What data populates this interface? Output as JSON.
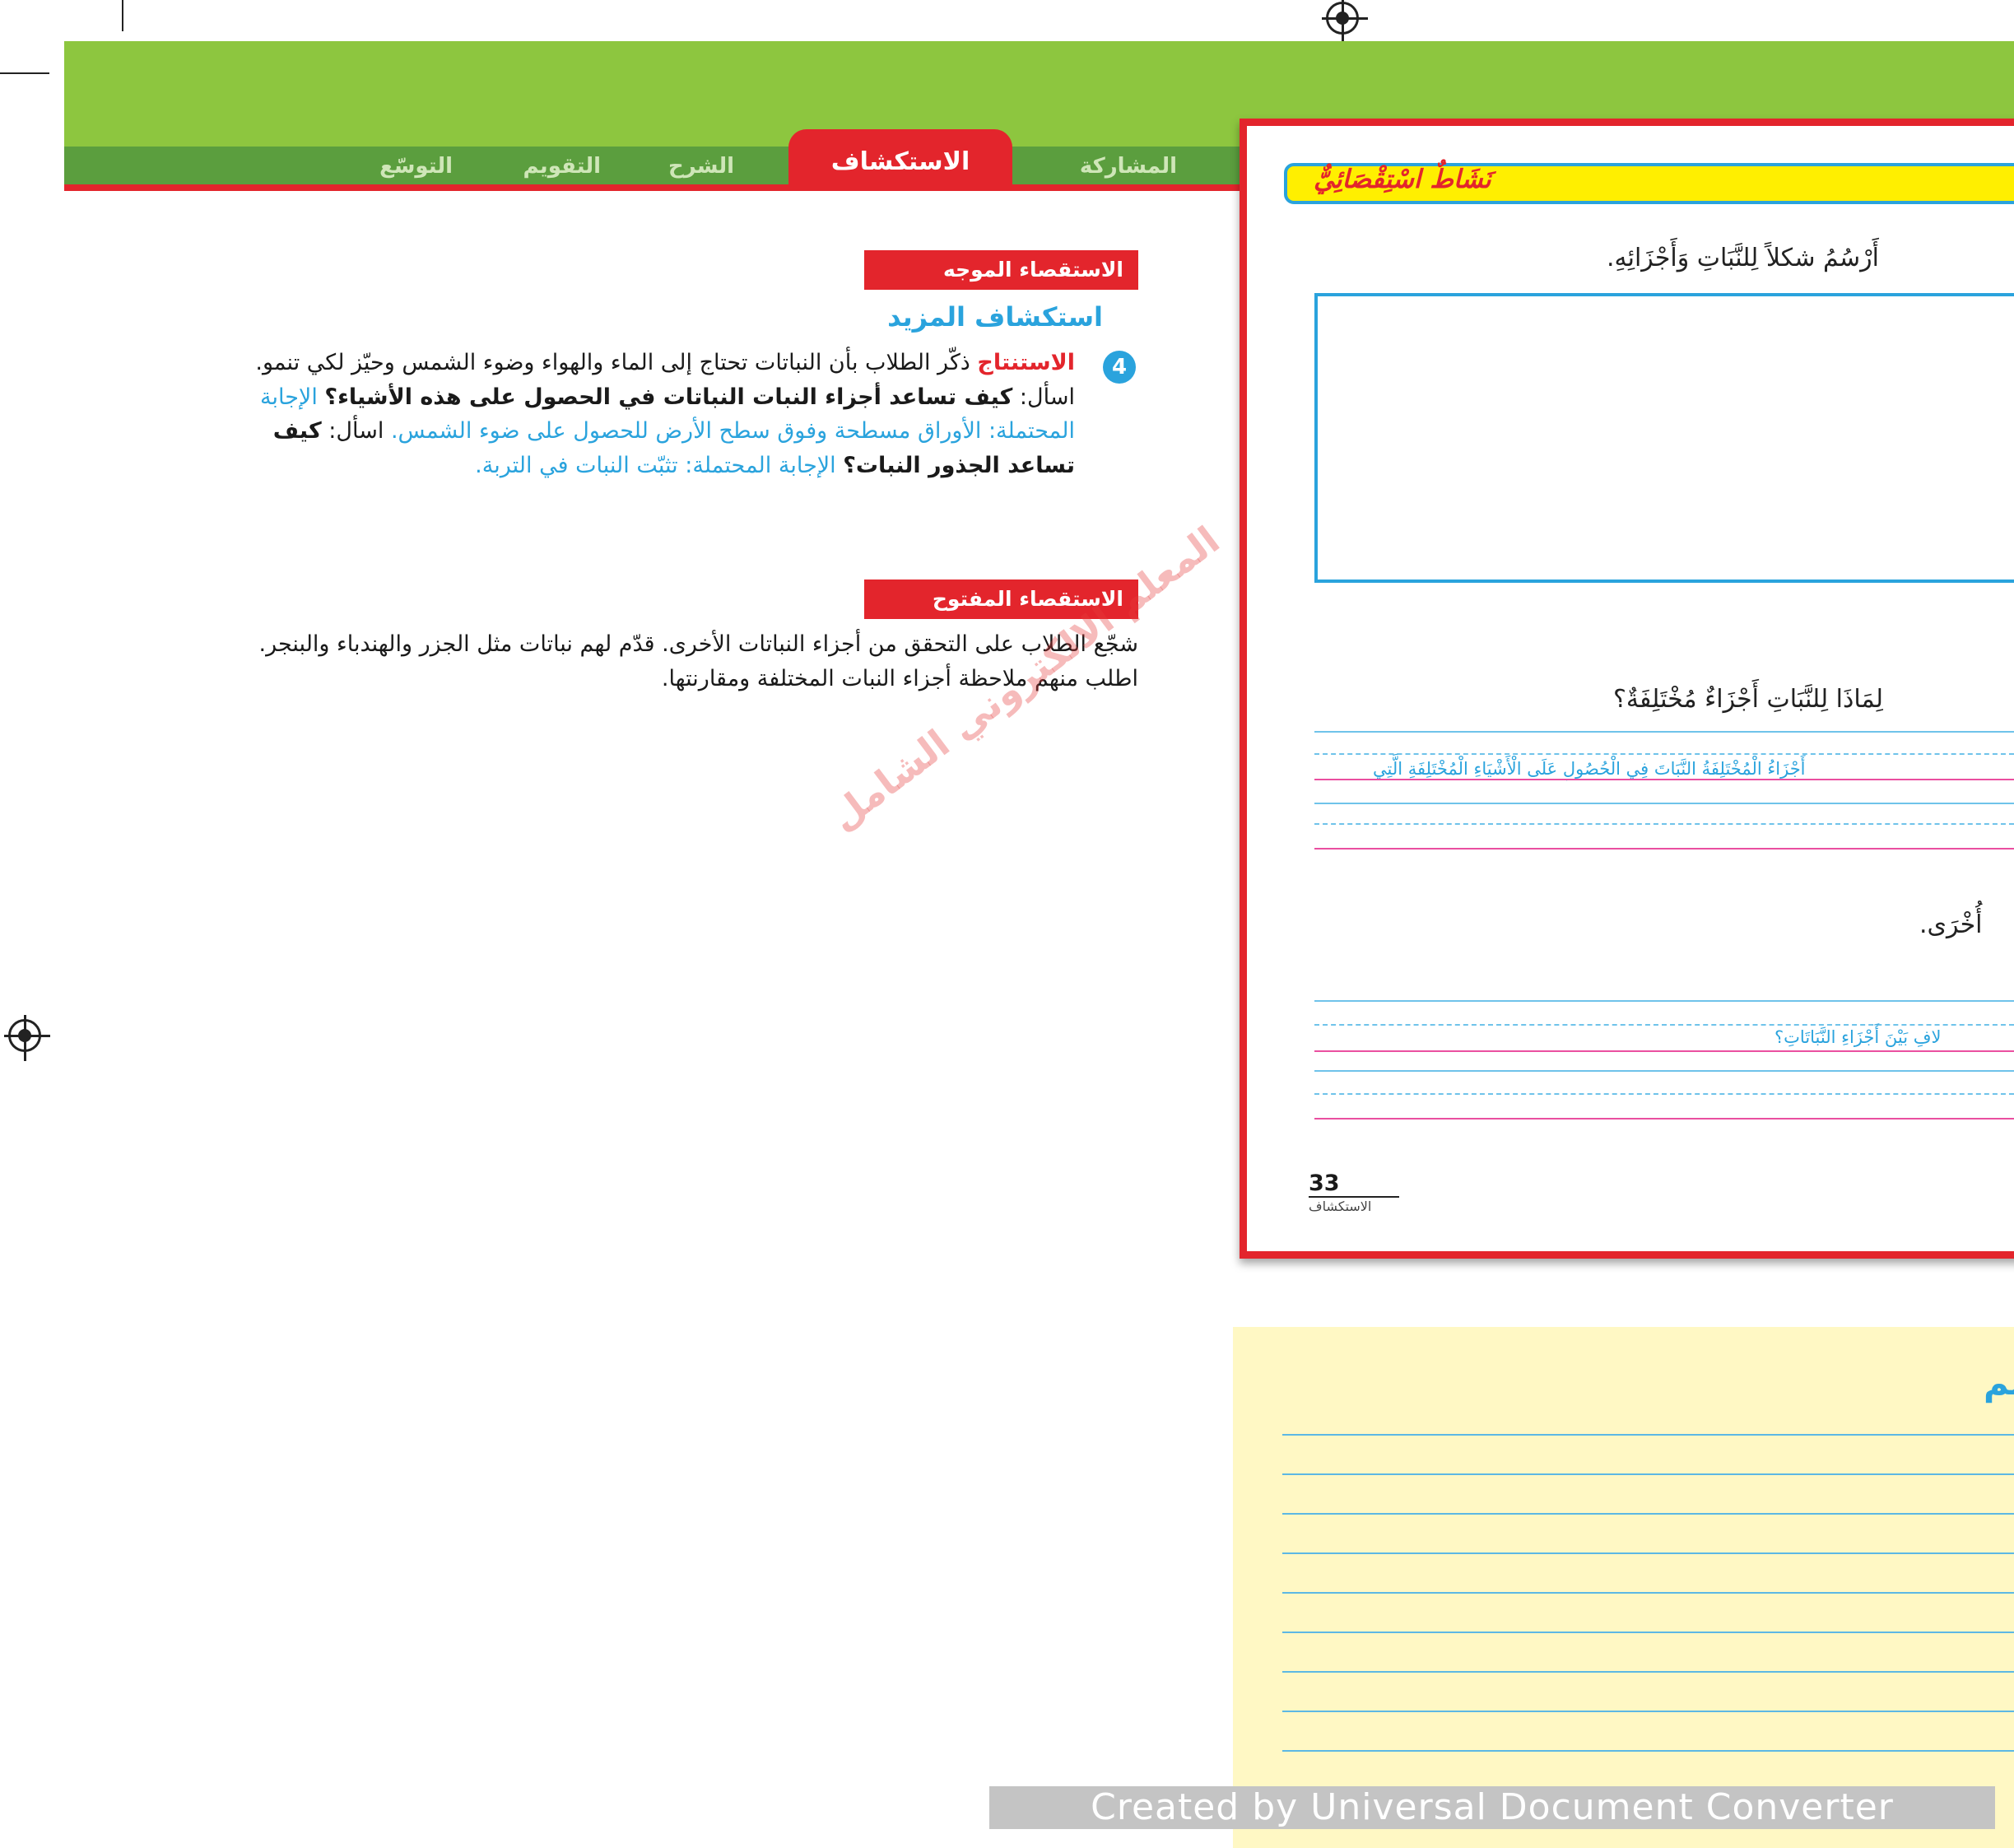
{
  "header": {
    "tabs": [
      {
        "label": "المشاركة",
        "active": false
      },
      {
        "label": "الاستكشاف",
        "active": true
      },
      {
        "label": "الشرح",
        "active": false
      },
      {
        "label": "التقويم",
        "active": false
      },
      {
        "label": "التوسّع",
        "active": false
      }
    ]
  },
  "guided_inquiry": {
    "label": "الاستقصاء الموجه",
    "heading": "استكشاف المزيد",
    "item_number": "4",
    "keyword": "الاستنتاج",
    "text_1": "ذكّر الطلاب بأن النباتات تحتاج إلى الماء والهواء وضوء الشمس وحيّز لكي تنمو. اسأل:",
    "question_1": "كيف تساعد أجزاء النبات النباتات في الحصول على هذه الأشياء؟",
    "answer_1": "الإجابة المحتملة: الأوراق مسطحة وفوق سطح الأرض للحصول على ضوء الشمس.",
    "ask_2": "اسأل:",
    "question_2": "كيف تساعد الجذور النبات؟",
    "answer_2": "الإجابة المحتملة: تثبّت النبات في التربة."
  },
  "open_inquiry": {
    "label": "الاستقصاء المفتوح",
    "text": "شجّع الطلاب على التحقق من أجزاء النباتات الأخرى. قدّم لهم نباتات مثل الجزر والهندباء والبنجر. اطلب منهم ملاحظة أجزاء النبات المختلفة ومقارنتها."
  },
  "watermark": "المعلم الالكتروني الشامل",
  "student_page": {
    "activity_title": "نَشَاطٌ اسْتِقْصَائِيٌّ",
    "instruction_1": "أَرْسُمُ شكلاً لِلنَّبَاتِ وَأَجْزَائِهِ.",
    "question_1": "لِمَاذَا لِلنَّبَاتِ أَجْزَاءٌ مُخْتَلِفَةٌ؟",
    "answer_1": "أَجْزَاءُ الْمُخْتَلِفَةُ النَّبَاتَ فِي الْحُصُولِ عَلَى الْأَشْيَاءِ الْمُخْتَلِفَةِ الَّتِي",
    "question_2_fragment": "أُخْرَى.",
    "answer_2": "لافِ بَيْنَ أَجْزَاءِ النَّبَاتَاتِ؟",
    "page_number": "33",
    "page_label": "الاستكشاف"
  },
  "notes": {
    "title": "علم"
  },
  "footer": {
    "converter_text": "Created by Universal Document Converter"
  },
  "colors": {
    "green": "#8dc63f",
    "dark_green": "#5b9e3e",
    "red": "#e3252c",
    "blue": "#2aa3dd",
    "yellow": "#ffef00",
    "notes_bg": "#fff8c4"
  }
}
